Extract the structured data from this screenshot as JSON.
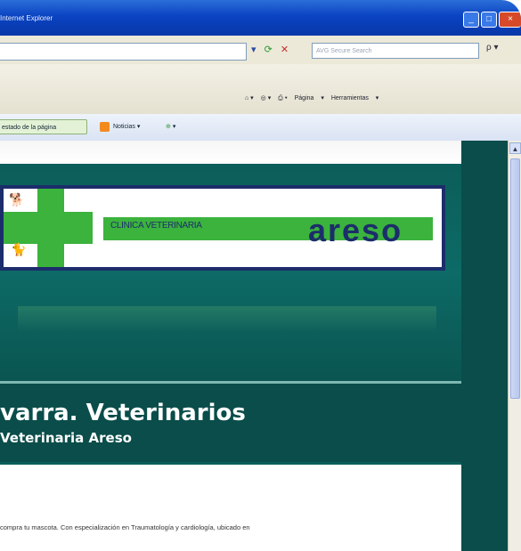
{
  "window": {
    "title": "Internet Explorer",
    "controls": [
      "minimize",
      "maximize",
      "close"
    ]
  },
  "address_bar": {
    "url": "",
    "icons": [
      "dropdown-icon",
      "refresh-icon",
      "stop-icon"
    ],
    "search_placeholder": "AVG Secure Search",
    "search_go": "ρ"
  },
  "command_bar": {
    "items": [
      "Página",
      "Herramientas"
    ]
  },
  "favorites_bar": {
    "button_label": "estado de la página",
    "news_label": "Noticias"
  },
  "page": {
    "logo": {
      "small_text": "CLINICA VETERINARIA",
      "brand": "areso"
    },
    "heading": "varra. Veterinarios",
    "subheading": "Veterinaria Areso",
    "intro_text": "compra tu mascota. Con especialización en Traumatología y cardiología, ubicado en"
  },
  "colors": {
    "banner_teal": "#0b5b57",
    "logo_green": "#3bb33d",
    "logo_navy": "#1c2d6b",
    "xp_blue": "#0a43c2"
  }
}
